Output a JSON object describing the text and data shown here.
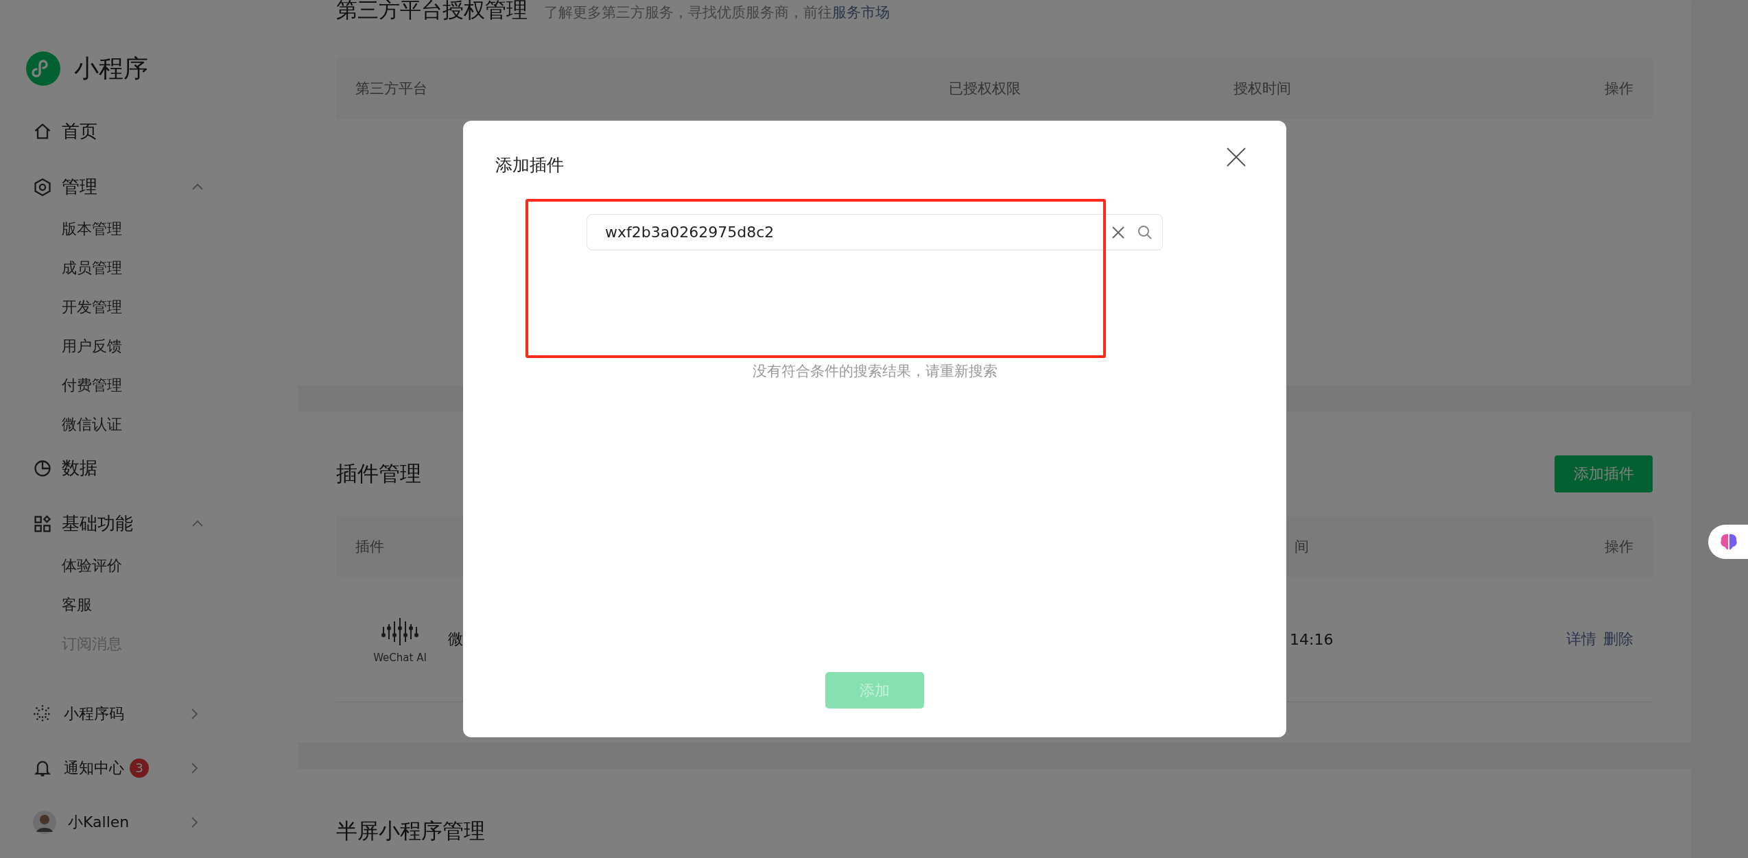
{
  "sidebar": {
    "logo": "小程序",
    "items": [
      {
        "kind": "link",
        "label": "首页"
      },
      {
        "kind": "group",
        "label": "管理",
        "expanded": true,
        "children": [
          {
            "label": "版本管理",
            "disabled": false
          },
          {
            "label": "成员管理",
            "disabled": false
          },
          {
            "label": "开发管理",
            "disabled": false
          },
          {
            "label": "用户反馈",
            "disabled": false
          },
          {
            "label": "付费管理",
            "disabled": false
          },
          {
            "label": "微信认证",
            "disabled": false
          }
        ]
      },
      {
        "kind": "link",
        "label": "数据"
      },
      {
        "kind": "group",
        "label": "基础功能",
        "expanded": true,
        "children": [
          {
            "label": "体验评价",
            "disabled": false
          },
          {
            "label": "客服",
            "disabled": false
          },
          {
            "label": "订阅消息",
            "disabled": true
          }
        ]
      }
    ],
    "bottom": [
      {
        "kind": "qrcode",
        "label": "小程序码"
      },
      {
        "kind": "bell",
        "label": "通知中心",
        "badge": "3"
      },
      {
        "kind": "user",
        "label": "小Kallen"
      }
    ]
  },
  "third_party": {
    "title": "第三方平台授权管理",
    "description": "了解更多第三方服务，寻找优质服务商，前往",
    "link": "服务市场",
    "columns": [
      "第三方平台",
      "已授权权限",
      "授权时间",
      "操作"
    ]
  },
  "plugins": {
    "title": "插件管理",
    "button": "添加插件",
    "columns": [
      "插件",
      "间",
      "操作"
    ],
    "rows": [
      {
        "logo_text": "WeChat AI",
        "name": "微",
        "time": "14:16",
        "actions": [
          "详情",
          "删除"
        ]
      }
    ]
  },
  "half_screen": {
    "title": "半屏小程序管理"
  },
  "modal": {
    "title": "添加插件",
    "search": {
      "value": "wxf2b3a0262975d8c2",
      "highlighted": true
    },
    "empty_message": "没有符合条件的搜索结果，请重新搜索",
    "add_button": {
      "label": "添加",
      "disabled": true
    }
  }
}
